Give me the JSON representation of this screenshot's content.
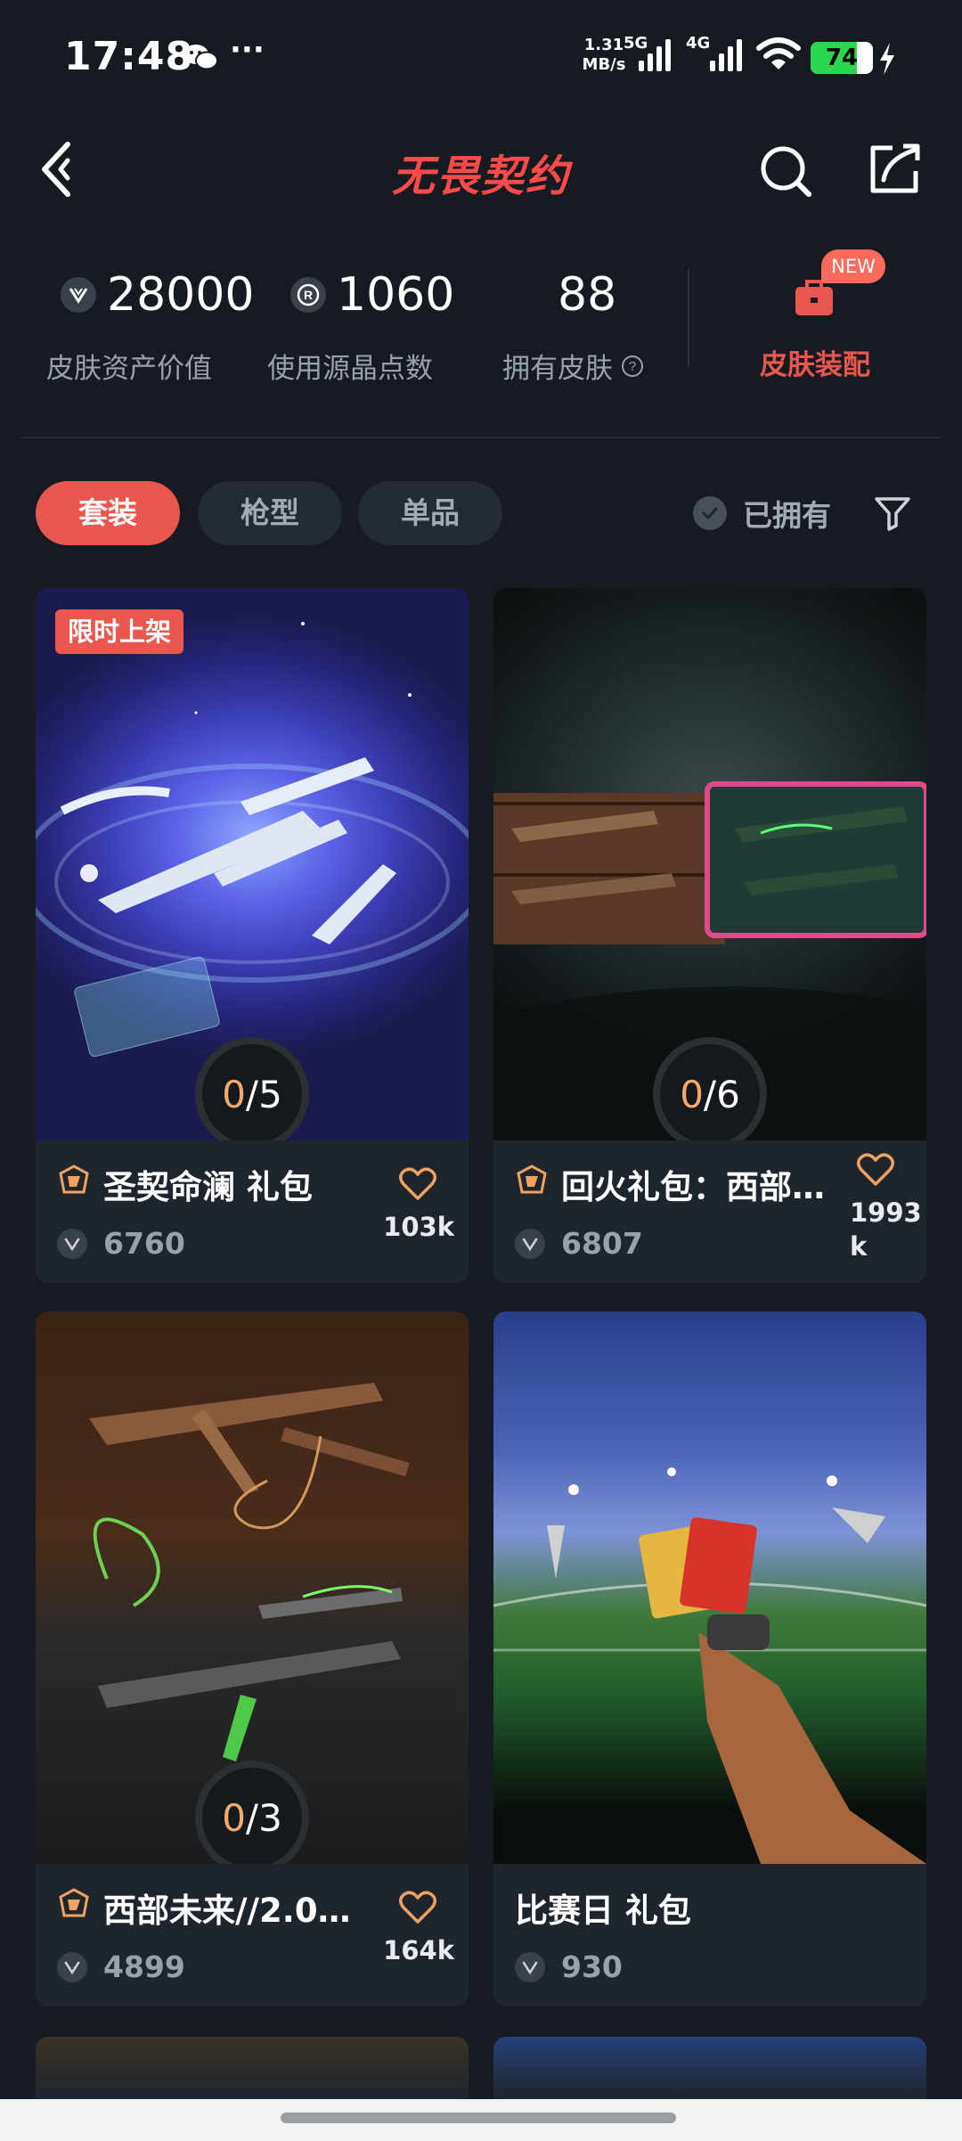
{
  "status_bar": {
    "time": "17:48",
    "more": "···",
    "speed": "1.31\nMB/s",
    "net1": "5G",
    "net2": "4G",
    "battery": "74",
    "battery_level": 0.74
  },
  "header": {
    "title": "无畏契约",
    "icons": [
      "back-icon",
      "search-icon",
      "share-icon"
    ]
  },
  "stats": {
    "asset_value": "28000",
    "asset_label": "皮肤资产价值",
    "points": "1060",
    "points_label": "使用源晶点数",
    "skins": "88",
    "skins_label": "拥有皮肤",
    "equip_label": "皮肤装配",
    "new_badge": "NEW"
  },
  "filters": {
    "tabs": [
      "套装",
      "枪型",
      "单品"
    ],
    "active_tab": "套装",
    "owned_label": "已拥有"
  },
  "cards": [
    {
      "title": "圣契命澜 礼包",
      "price": "6760",
      "likes": "103k",
      "progress_owned": "0",
      "progress_total": "5",
      "tag": "限时上架"
    },
    {
      "title": "回火礼包：西部…",
      "price": "6807",
      "likes": "1993\nk",
      "progress_owned": "0",
      "progress_total": "6"
    },
    {
      "title": "西部未来//2.0…",
      "price": "4899",
      "likes": "164k",
      "progress_owned": "0",
      "progress_total": "3"
    },
    {
      "title": "比赛日 礼包",
      "price": "930"
    }
  ],
  "colors": {
    "accent": "#e9574f",
    "background": "#161b22",
    "card": "#1f252d"
  }
}
